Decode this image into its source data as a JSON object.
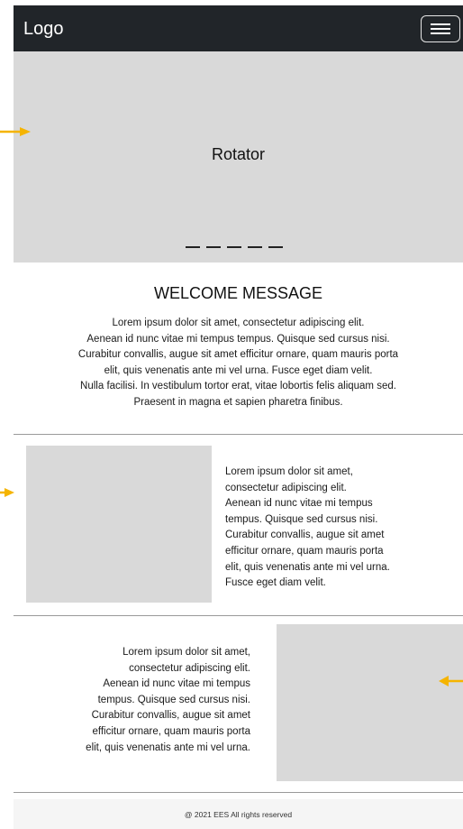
{
  "navbar": {
    "logo": "Logo",
    "menu_icon": "hamburger-menu-icon"
  },
  "rotator": {
    "title": "Rotator",
    "indicator_count": 5
  },
  "welcome": {
    "title": "WELCOME MESSAGE",
    "text": "Lorem ipsum dolor sit amet, consectetur adipiscing elit.\nAenean id nunc vitae mi tempus tempus. Quisque sed cursus nisi.\nCurabitur convallis, augue sit amet efficitur ornare, quam mauris porta\nelit, quis venenatis ante mi vel urna. Fusce eget diam velit.\nNulla facilisi. In vestibulum tortor erat, vitae lobortis felis aliquam sed.\nPraesent in magna et sapien pharetra finibus."
  },
  "section1": {
    "text": "Lorem ipsum dolor sit amet,\nconsectetur adipiscing elit.\nAenean id nunc vitae mi tempus\ntempus. Quisque sed cursus nisi.\nCurabitur convallis, augue sit amet\nefficitur ornare, quam mauris porta\nelit, quis venenatis ante mi vel urna.\nFusce eget diam velit."
  },
  "section2": {
    "text": "Lorem ipsum dolor sit amet,\nconsectetur adipiscing elit.\nAenean id nunc vitae mi tempus\ntempus. Quisque sed cursus nisi.\nCurabitur convallis, augue sit amet\nefficitur ornare, quam mauris porta\nelit, quis venenatis ante mi vel urna."
  },
  "footer": {
    "text": "@ 2021 EES All rights reserved"
  },
  "colors": {
    "navbar": "#212529",
    "placeholder": "#d9d9d9",
    "arrow": "#f5b400",
    "footer": "#f5f5f5"
  },
  "annotations": {
    "arrow_icons": [
      "arrow-right-icon",
      "arrow-right-icon",
      "arrow-left-icon"
    ]
  }
}
